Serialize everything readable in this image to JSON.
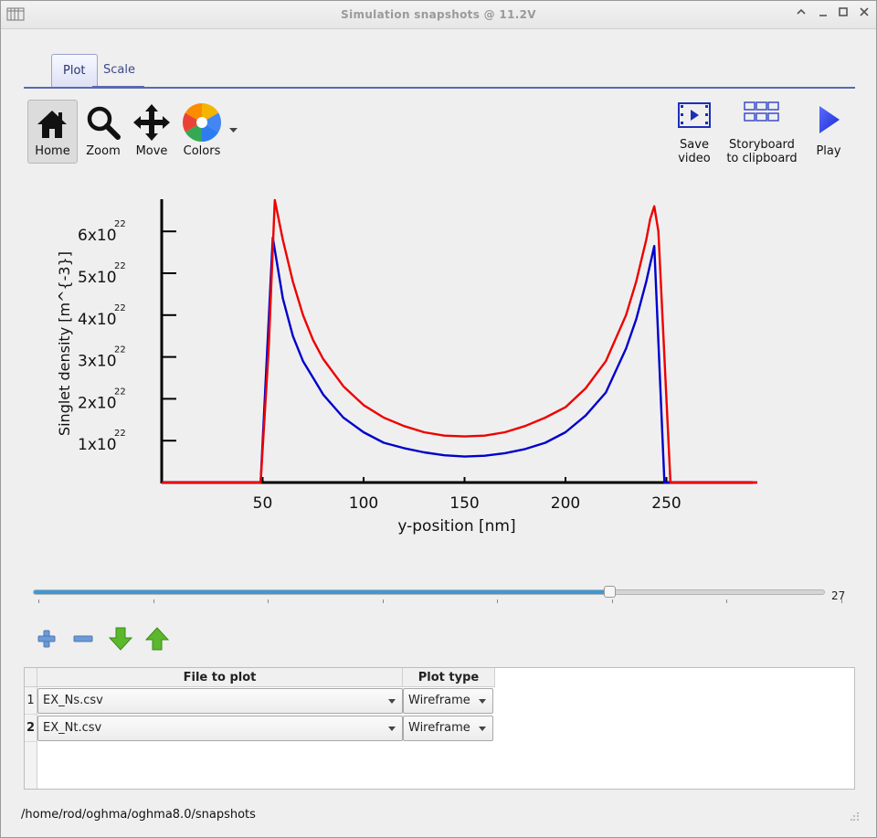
{
  "window": {
    "title": "Simulation snapshots @ 11.2V"
  },
  "tabs": [
    {
      "label": "Plot"
    },
    {
      "label": "Scale"
    }
  ],
  "toolbar": {
    "home": "Home",
    "zoom": "Zoom",
    "move": "Move",
    "colors": "Colors",
    "save_video_1": "Save",
    "save_video_2": "video",
    "storyboard_1": "Storyboard",
    "storyboard_2": "to clipboard",
    "play": "Play"
  },
  "chart_data": {
    "type": "line",
    "xlabel": "y-position [nm]",
    "ylabel": "Singlet density [m^{-3}]",
    "xlim": [
      0,
      295
    ],
    "ylim": [
      0,
      6.8e+22
    ],
    "xticks": [
      50,
      100,
      150,
      200,
      250
    ],
    "yticks": [
      {
        "value": 1e+22,
        "mantissa": "1x10",
        "exponent": "22"
      },
      {
        "value": 2e+22,
        "mantissa": "2x10",
        "exponent": "22"
      },
      {
        "value": 3e+22,
        "mantissa": "3x10",
        "exponent": "22"
      },
      {
        "value": 4e+22,
        "mantissa": "4x10",
        "exponent": "22"
      },
      {
        "value": 5e+22,
        "mantissa": "5x10",
        "exponent": "22"
      },
      {
        "value": 6e+22,
        "mantissa": "6x10",
        "exponent": "22"
      }
    ],
    "series": [
      {
        "color": "#0000cc",
        "x": [
          0,
          46,
          49,
          55,
          60,
          65,
          70,
          75,
          80,
          90,
          100,
          110,
          120,
          130,
          140,
          150,
          160,
          170,
          180,
          190,
          200,
          210,
          220,
          230,
          235,
          240,
          244,
          249,
          252,
          295
        ],
        "y": [
          0,
          0,
          0,
          5.85e+22,
          4.4e+22,
          3.5e+22,
          2.9e+22,
          2.5e+22,
          2.1e+22,
          1.55e+22,
          1.2e+22,
          9.5e+21,
          8.2e+21,
          7.2e+21,
          6.5e+21,
          6.2e+21,
          6.4e+21,
          7e+21,
          8e+21,
          9.5e+21,
          1.2e+22,
          1.6e+22,
          2.15e+22,
          3.2e+22,
          3.9e+22,
          4.8e+22,
          5.65e+22,
          0,
          0,
          0
        ]
      },
      {
        "color": "#ee0000",
        "x": [
          0,
          46,
          49,
          53,
          56,
          60,
          65,
          70,
          75,
          80,
          90,
          100,
          110,
          120,
          130,
          140,
          150,
          160,
          170,
          180,
          190,
          200,
          210,
          220,
          230,
          235,
          240,
          242,
          244,
          246,
          250,
          252,
          295
        ],
        "y": [
          0,
          0,
          0,
          3.2e+22,
          6.75e+22,
          5.8e+22,
          4.8e+22,
          4e+22,
          3.4e+22,
          2.95e+22,
          2.3e+22,
          1.85e+22,
          1.55e+22,
          1.35e+22,
          1.2e+22,
          1.12e+22,
          1.1e+22,
          1.12e+22,
          1.2e+22,
          1.35e+22,
          1.55e+22,
          1.8e+22,
          2.25e+22,
          2.9e+22,
          4e+22,
          4.8e+22,
          5.8e+22,
          6.3e+22,
          6.6e+22,
          6e+22,
          2e+22,
          0,
          0
        ]
      }
    ]
  },
  "slider": {
    "value": 27,
    "max": 37
  },
  "table": {
    "headers": {
      "file": "File to plot",
      "type": "Plot type"
    },
    "rows": [
      {
        "num": "1",
        "file": "EX_Ns.csv",
        "type": "Wireframe"
      },
      {
        "num": "2",
        "file": "EX_Nt.csv",
        "type": "Wireframe"
      }
    ]
  },
  "status": {
    "path": "/home/rod/oghma/oghma8.0/snapshots"
  }
}
